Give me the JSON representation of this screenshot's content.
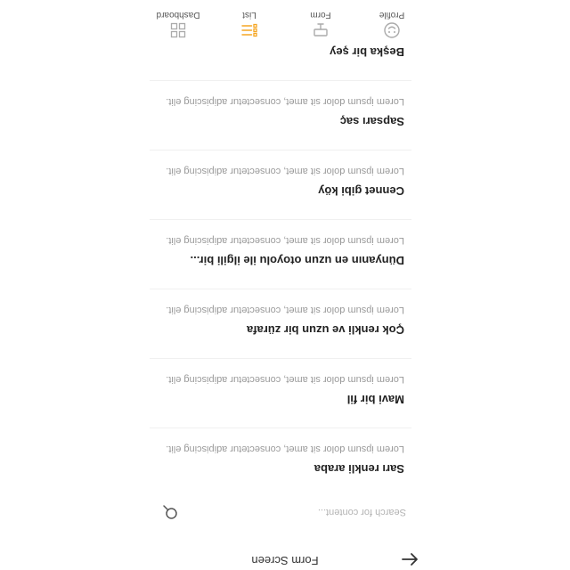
{
  "header": {
    "title": "Form Screen",
    "back_icon": "arrow-left-icon"
  },
  "search": {
    "placeholder": "Search for content...",
    "value": "",
    "icon": "search-icon"
  },
  "list": {
    "items": [
      {
        "title": "Sarı renkli araba",
        "description": "Lorem ipsum dolor sit amet, consectetur adipiscing elit."
      },
      {
        "title": "Mavi bir fil",
        "description": "Lorem ipsum dolor sit amet, consectetur adipiscing elit."
      },
      {
        "title": "Çok renkli ve uzun bir zürafa",
        "description": "Lorem ipsum dolor sit amet, consectetur adipiscing elit."
      },
      {
        "title": "Dünyanın en uzun otoyolu ile ilgili bir...",
        "description": "Lorem ipsum dolor sit amet, consectetur adipiscing elit."
      },
      {
        "title": "Cennet gibi köy",
        "description": "Lorem ipsum dolor sit amet, consectetur adipiscing elit."
      },
      {
        "title": "Sapsarı saç",
        "description": "Lorem ipsum dolor sit amet, consectetur adipiscing elit."
      },
      {
        "title": "Beşka bir şey",
        "description": ""
      }
    ]
  },
  "tabs": [
    {
      "label": "Profile",
      "icon": "smile-icon",
      "active": false
    },
    {
      "label": "Form",
      "icon": "form-icon",
      "active": false
    },
    {
      "label": "List",
      "icon": "list-icon",
      "active": true
    },
    {
      "label": "Dashboard",
      "icon": "grid-icon",
      "active": false
    }
  ],
  "colors": {
    "accent": "#f5a623",
    "text": "#222222",
    "muted": "#999999",
    "icon": "#aaaaaa"
  }
}
